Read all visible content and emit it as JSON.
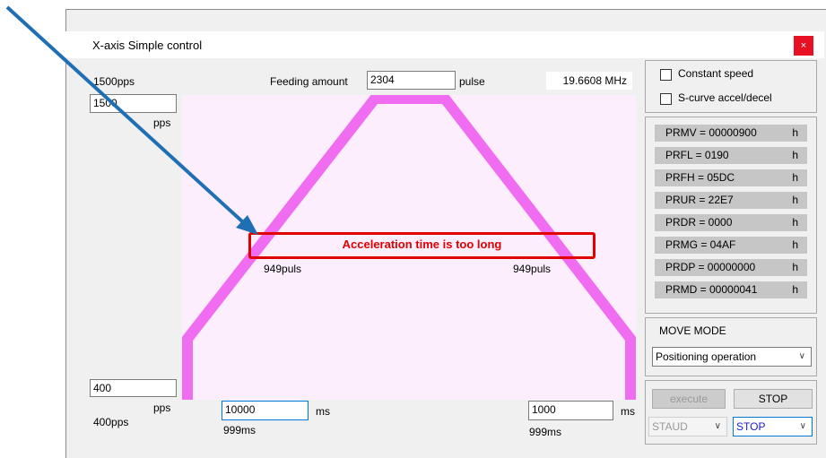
{
  "window": {
    "title": "X-axis Simple control",
    "close_glyph": "×"
  },
  "top": {
    "max_pps_label": "1500pps",
    "feeding_label": "Feeding amount",
    "feeding_value": "2304",
    "pulse_label": "pulse",
    "frequency": "19.6608 MHz"
  },
  "left": {
    "max_speed_value": "1500",
    "max_speed_unit": "pps",
    "min_speed_value": "400",
    "min_speed_unit": "pps",
    "min_pps_label": "400pps"
  },
  "plot": {
    "warning": "Acceleration time is too long",
    "accel_pulses": "949puls",
    "decel_pulses": "949puls",
    "profile_color": "#f06cf0",
    "background_color": "#fdeefd"
  },
  "bottom": {
    "accel_time_value": "10000",
    "accel_time_unit": "ms",
    "accel_time_actual": "999ms",
    "decel_time_value": "1000",
    "decel_time_unit": "ms",
    "decel_time_actual": "999ms"
  },
  "options": {
    "constant_speed": "Constant speed",
    "s_curve": "S-curve accel/decel",
    "constant_speed_checked": false,
    "s_curve_checked": false
  },
  "registers": [
    {
      "text": "PRMV = 00000900",
      "unit": "h"
    },
    {
      "text": "PRFL = 0190",
      "unit": "h"
    },
    {
      "text": "PRFH = 05DC",
      "unit": "h"
    },
    {
      "text": "PRUR = 22E7",
      "unit": "h"
    },
    {
      "text": "PRDR = 0000",
      "unit": "h"
    },
    {
      "text": "PRMG = 04AF",
      "unit": "h"
    },
    {
      "text": "PRDP = 00000000",
      "unit": "h"
    },
    {
      "text": "PRMD = 00000041",
      "unit": "h"
    }
  ],
  "move_mode": {
    "label": "MOVE MODE",
    "selected": "Positioning operation"
  },
  "actions": {
    "execute": "execute",
    "stop": "STOP",
    "status_left": "STAUD",
    "status_right": "STOP"
  },
  "annotation": {
    "arrow_color": "#1f6fb5",
    "box_color": "#e00000"
  }
}
